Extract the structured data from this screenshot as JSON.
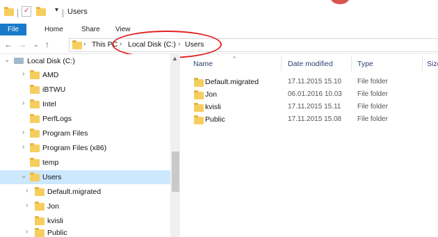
{
  "window": {
    "title": "Users"
  },
  "ribbon": {
    "tabs": [
      "File",
      "Home",
      "Share",
      "View"
    ]
  },
  "address": {
    "crumbs": [
      "This PC",
      "Local Disk (C:)",
      "Users"
    ]
  },
  "tree": {
    "items": [
      {
        "label": "Local Disk (C:)",
        "indent": 0,
        "expanded": true,
        "icon": "drive-icon"
      },
      {
        "label": "AMD",
        "indent": 1,
        "chevron": true
      },
      {
        "label": "iBTWU",
        "indent": 1,
        "chevron": false
      },
      {
        "label": "Intel",
        "indent": 1,
        "chevron": true
      },
      {
        "label": "PerfLogs",
        "indent": 1,
        "chevron": false
      },
      {
        "label": "Program Files",
        "indent": 1,
        "chevron": true
      },
      {
        "label": "Program Files (x86)",
        "indent": 1,
        "chevron": true
      },
      {
        "label": "temp",
        "indent": 1,
        "chevron": false
      },
      {
        "label": "Users",
        "indent": 1,
        "chevron": true,
        "expanded": true,
        "selected": true
      },
      {
        "label": "Default.migrated",
        "indent": 2,
        "chevron": true
      },
      {
        "label": "Jon",
        "indent": 2,
        "chevron": true
      },
      {
        "label": "kvisli",
        "indent": 2,
        "chevron": false
      },
      {
        "label": "Public",
        "indent": 2,
        "chevron": true
      }
    ]
  },
  "list": {
    "columns": {
      "name": "Name",
      "date": "Date modified",
      "type": "Type",
      "size": "Size"
    },
    "rows": [
      {
        "name": "Default.migrated",
        "date": "17.11.2015 15.10",
        "type": "File folder"
      },
      {
        "name": "Jon",
        "date": "06.01.2016 10.03",
        "type": "File folder"
      },
      {
        "name": "kvisli",
        "date": "17.11.2015 15.11",
        "type": "File folder"
      },
      {
        "name": "Public",
        "date": "17.11.2015 15.08",
        "type": "File folder"
      }
    ]
  },
  "colors": {
    "accent": "#1979ca",
    "selection": "#cce8ff",
    "folder": "#f6ce5f",
    "annotation": "#e02020"
  }
}
